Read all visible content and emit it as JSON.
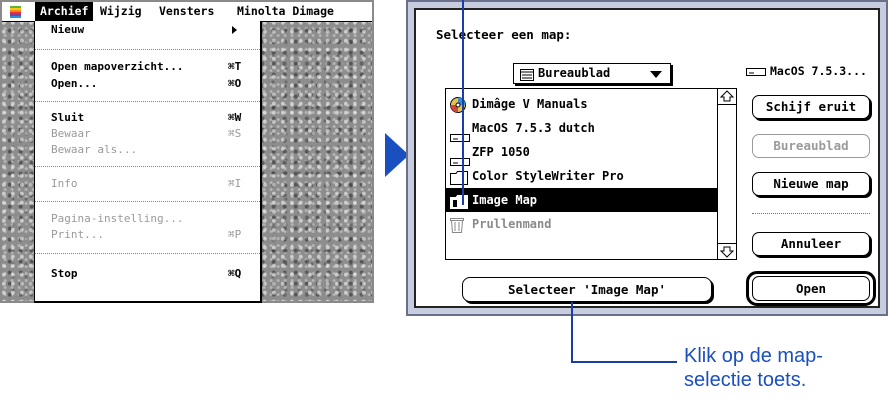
{
  "menubar": {
    "apple_icon": "apple-icon",
    "items": [
      "Archief",
      "Wijzig",
      "Vensters",
      "Minolta Dimage"
    ]
  },
  "file_menu": {
    "items": [
      {
        "label": "Nieuw",
        "shortcut": "",
        "submenu": true
      },
      {
        "label": "Open mapoverzicht...",
        "shortcut": "⌘T"
      },
      {
        "label": "Open...",
        "shortcut": "⌘O"
      },
      {
        "label": "Sluit",
        "shortcut": "⌘W"
      },
      {
        "label": "Bewaar",
        "shortcut": "⌘S",
        "disabled": true
      },
      {
        "label": "Bewaar als...",
        "shortcut": "",
        "disabled": true
      },
      {
        "label": "Info",
        "shortcut": "⌘I",
        "disabled": true
      },
      {
        "label": "Pagina-instelling...",
        "shortcut": "",
        "disabled": true
      },
      {
        "label": "Print...",
        "shortcut": "⌘P",
        "disabled": true
      },
      {
        "label": "Stop",
        "shortcut": "⌘Q"
      }
    ]
  },
  "dialog": {
    "title": "Selecteer een map:",
    "folder_popup": "Bureaublad",
    "disk_name": "MacOS 7.5.3...",
    "files": [
      {
        "name": "Dimâge V Manuals",
        "icon": "cd-icon"
      },
      {
        "name": "MacOS 7.5.3 dutch",
        "icon": "disk-icon"
      },
      {
        "name": "ZFP 1050",
        "icon": "disk-icon"
      },
      {
        "name": "Color StyleWriter Pro",
        "icon": "folder-icon"
      },
      {
        "name": "Image Map",
        "icon": "folder-icon",
        "selected": true
      },
      {
        "name": "Prullenmand",
        "icon": "trash-icon",
        "dimmed": true
      }
    ],
    "buttons": {
      "eject": "Schijf eruit",
      "desktop": "Bureaublad",
      "new_folder": "Nieuwe map",
      "cancel": "Annuleer",
      "select": "Selecteer 'Image Map'",
      "open": "Open"
    }
  },
  "caption": {
    "line1": "Klik op de map-",
    "line2": "selectie toets."
  },
  "colors": {
    "callout": "#1a3ea8",
    "caption_text": "#1a4fc0",
    "dialog_frame": "#c8ccdf"
  }
}
